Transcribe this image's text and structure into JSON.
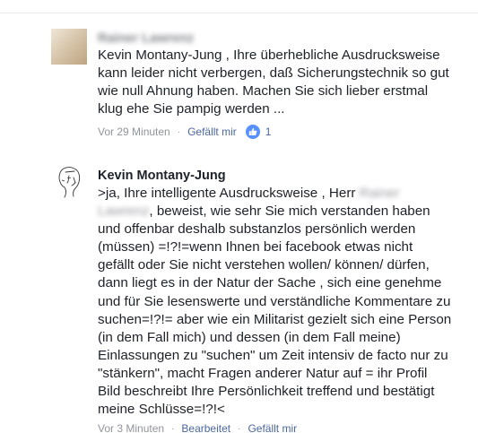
{
  "comments": [
    {
      "author": "Rainer Lawrenz",
      "lines": [
        "Kevin Montany-Jung , Ihre überhebliche Ausdrucksweise",
        "kann leider nicht verbergen, daß Sicherungstechnik so gut",
        "wie null Ahnung haben. Machen Sie sich lieber erstmal",
        "klug ehe Sie pampig werden ..."
      ],
      "time": "Vor 29 Minuten",
      "like_label": "Gefällt mir",
      "like_count": "1"
    },
    {
      "author": "Kevin Montany-Jung",
      "line_1_prefix": ">ja, Ihre intelligente Ausdrucksweise , Herr ",
      "line_1_redacted": "Rainer",
      "line_2_redacted": "Lawrenz",
      "line_2_suffix": ", beweist, wie sehr Sie mich verstanden haben",
      "lines": [
        "und offenbar deshalb substanzlos persönlich werden",
        "(müssen) =!?!=wenn Ihnen  bei facebook etwas nicht",
        "gefällt oder Sie nicht verstehen wollen/ können/ dürfen,",
        "dann liegt es in der Natur der Sache , sich eine genehme",
        "und für Sie lesenswerte und verständliche Kommentare zu",
        "suchen=!?!= aber wie ein Militarist gezielt sich eine Person",
        "(in dem Fall mich)  und dessen (in dem Fall meine)",
        "Einlassungen zu \"suchen\"  um Zeit intensiv de facto nur zu",
        "\"stänkern\", macht Fragen anderer Natur auf = ihr Profil",
        "Bild beschreibt Ihre Persönlichkeit treffend und bestätigt",
        "meine Schlüsse=!?!<"
      ],
      "time": "Vor 3 Minuten",
      "edit_label": "Bearbeitet",
      "like_label": "Gefällt mir"
    }
  ],
  "icons": {
    "separator": "·",
    "like": "thumbs-up-icon"
  },
  "colors": {
    "like_blue": "#5890ff",
    "link_blue": "#4b67a1",
    "meta_gray": "#90949c"
  }
}
